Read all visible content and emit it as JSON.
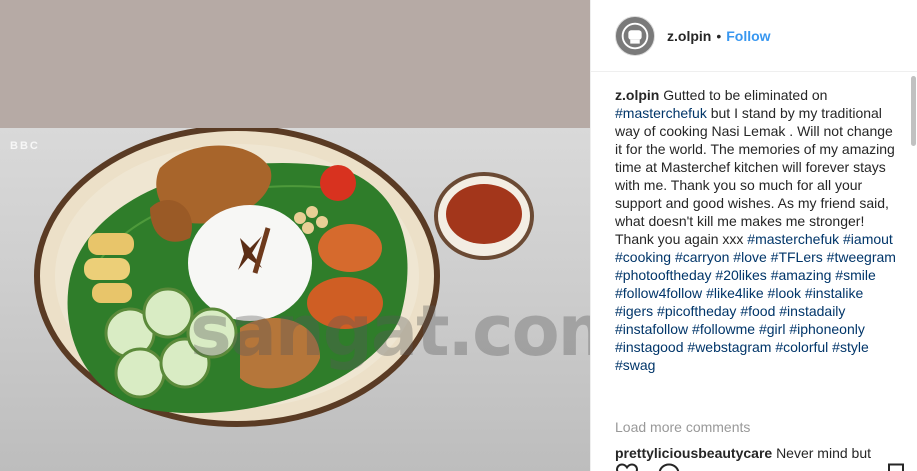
{
  "post": {
    "username": "z.olpin",
    "follow_label": "Follow",
    "separator": "•"
  },
  "media": {
    "bbc_logo": "BBC",
    "watermark": "sangat.com"
  },
  "caption": {
    "username": "z.olpin",
    "lead": "Gutted to be eliminated on",
    "segments": [
      {
        "type": "tag",
        "text": "#masterchefuk"
      },
      {
        "type": "text",
        "text": " but I stand by my traditional way of cooking Nasi Lemak . Will not change it for the world. The memories of my amazing time at Masterchef kitchen will forever stays with me. Thank you so much for all your support and good wishes. As my friend said, what doesn't kill me makes me stronger! Thank you again xxx "
      },
      {
        "type": "tag",
        "text": "#masterchefuk"
      },
      {
        "type": "text",
        "text": " "
      },
      {
        "type": "tag",
        "text": "#iamout"
      },
      {
        "type": "text",
        "text": " "
      },
      {
        "type": "tag",
        "text": "#cooking"
      },
      {
        "type": "text",
        "text": " "
      },
      {
        "type": "tag",
        "text": "#carryon"
      },
      {
        "type": "text",
        "text": " "
      },
      {
        "type": "tag",
        "text": "#love"
      },
      {
        "type": "text",
        "text": " "
      },
      {
        "type": "tag",
        "text": "#TFLers"
      },
      {
        "type": "text",
        "text": " "
      },
      {
        "type": "tag",
        "text": "#tweegram"
      },
      {
        "type": "text",
        "text": " "
      },
      {
        "type": "tag",
        "text": "#photooftheday"
      },
      {
        "type": "text",
        "text": " "
      },
      {
        "type": "tag",
        "text": "#20likes"
      },
      {
        "type": "text",
        "text": " "
      },
      {
        "type": "tag",
        "text": "#amazing"
      },
      {
        "type": "text",
        "text": " "
      },
      {
        "type": "tag",
        "text": "#smile"
      },
      {
        "type": "text",
        "text": " "
      },
      {
        "type": "tag",
        "text": "#follow4follow"
      },
      {
        "type": "text",
        "text": " "
      },
      {
        "type": "tag",
        "text": "#like4like"
      },
      {
        "type": "text",
        "text": " "
      },
      {
        "type": "tag",
        "text": "#look"
      },
      {
        "type": "text",
        "text": " "
      },
      {
        "type": "tag",
        "text": "#instalike"
      },
      {
        "type": "text",
        "text": " "
      },
      {
        "type": "tag",
        "text": "#igers"
      },
      {
        "type": "text",
        "text": " "
      },
      {
        "type": "tag",
        "text": "#picoftheday"
      },
      {
        "type": "text",
        "text": " "
      },
      {
        "type": "tag",
        "text": "#food"
      },
      {
        "type": "text",
        "text": " "
      },
      {
        "type": "tag",
        "text": "#instadaily"
      },
      {
        "type": "text",
        "text": " "
      },
      {
        "type": "tag",
        "text": "#instafollow"
      },
      {
        "type": "text",
        "text": " "
      },
      {
        "type": "tag",
        "text": "#followme"
      },
      {
        "type": "text",
        "text": " "
      },
      {
        "type": "tag",
        "text": "#girl"
      },
      {
        "type": "text",
        "text": " "
      },
      {
        "type": "tag",
        "text": "#iphoneonly"
      },
      {
        "type": "text",
        "text": " "
      },
      {
        "type": "tag",
        "text": "#instagood"
      },
      {
        "type": "text",
        "text": " "
      },
      {
        "type": "tag",
        "text": "#webstagram"
      },
      {
        "type": "text",
        "text": " "
      },
      {
        "type": "tag",
        "text": "#colorful"
      },
      {
        "type": "text",
        "text": " "
      },
      {
        "type": "tag",
        "text": "#style"
      },
      {
        "type": "text",
        "text": " "
      },
      {
        "type": "tag",
        "text": "#swag"
      }
    ]
  },
  "comments": {
    "load_more_label": "Load more comments",
    "next": {
      "username": "prettyliciousbeautycare",
      "text": "Never mind but"
    }
  },
  "icons": {
    "like": "heart-icon",
    "comment": "comment-icon",
    "save": "bookmark-icon"
  },
  "colors": {
    "link": "#3897f0",
    "hashtag": "#003569",
    "muted": "#999999"
  }
}
